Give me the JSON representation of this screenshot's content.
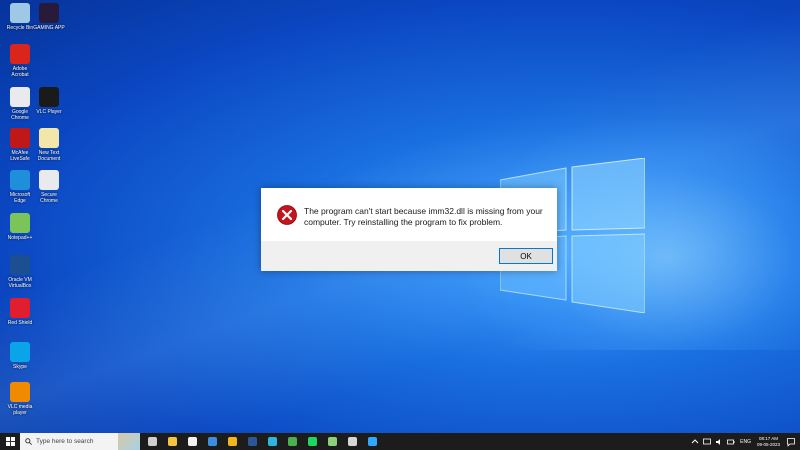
{
  "desktop": {
    "icons": [
      {
        "label": "Recycle Bin",
        "icon": "recycle-bin-icon",
        "color": "#9fc7e6"
      },
      {
        "label": "GAMING APP",
        "icon": "game-app-icon",
        "color": "#2a1a3a"
      },
      {
        "label": "Adobe Acrobat",
        "icon": "acrobat-icon",
        "color": "#d9251c"
      },
      {
        "label": "Google Chrome",
        "icon": "chrome-icon",
        "color": "#e8eaed"
      },
      {
        "label": "VLC Player",
        "icon": "vlc-icon",
        "color": "#1a1a1a"
      },
      {
        "label": "McAfee LiveSafe",
        "icon": "mcafee-icon",
        "color": "#c01818"
      },
      {
        "label": "New Text Document",
        "icon": "text-document-icon",
        "color": "#f2e6a8"
      },
      {
        "label": "Microsoft Edge",
        "icon": "edge-icon",
        "color": "#1e8fd8"
      },
      {
        "label": "Secure Chrome",
        "icon": "chrome-icon",
        "color": "#e8eaed"
      },
      {
        "label": "Notepad++",
        "icon": "notepad-icon",
        "color": "#7bc45a"
      },
      {
        "label": "Oracle VM VirtualBox",
        "icon": "virtualbox-icon",
        "color": "#1b4f91"
      },
      {
        "label": "Red Shield",
        "icon": "shield-icon",
        "color": "#e01e30"
      },
      {
        "label": "Skype",
        "icon": "skype-icon",
        "color": "#0aa4e8"
      },
      {
        "label": "VLC media player",
        "icon": "vlc-cone-icon",
        "color": "#f08a00"
      }
    ]
  },
  "dialog": {
    "message": "The program can't start because imm32.dll is missing from your computer. Try reinstalling the program to fix problem.",
    "ok_label": "OK",
    "icon": "error-icon"
  },
  "taskbar": {
    "search_placeholder": "Type here to search",
    "apps": [
      {
        "icon": "task-view-icon",
        "color": "#cfcfcf"
      },
      {
        "icon": "file-explorer-icon",
        "color": "#f5c542"
      },
      {
        "icon": "store-icon",
        "color": "#f2f2f2"
      },
      {
        "icon": "mail-icon",
        "color": "#3c8ee0"
      },
      {
        "icon": "chrome-icon",
        "color": "#f2b51c"
      },
      {
        "icon": "word-icon",
        "color": "#2b5797"
      },
      {
        "icon": "edge-icon",
        "color": "#2db4e0"
      },
      {
        "icon": "chrome-icon",
        "color": "#4caf50"
      },
      {
        "icon": "spotify-icon",
        "color": "#1ed760"
      },
      {
        "icon": "notepad-icon",
        "color": "#8bd17c"
      },
      {
        "icon": "files-icon",
        "color": "#d6d6d6"
      },
      {
        "icon": "photoshop-icon",
        "color": "#31a8ff"
      }
    ],
    "language": "ENG",
    "time": "08:17 AM",
    "date": "09-05-2023"
  }
}
